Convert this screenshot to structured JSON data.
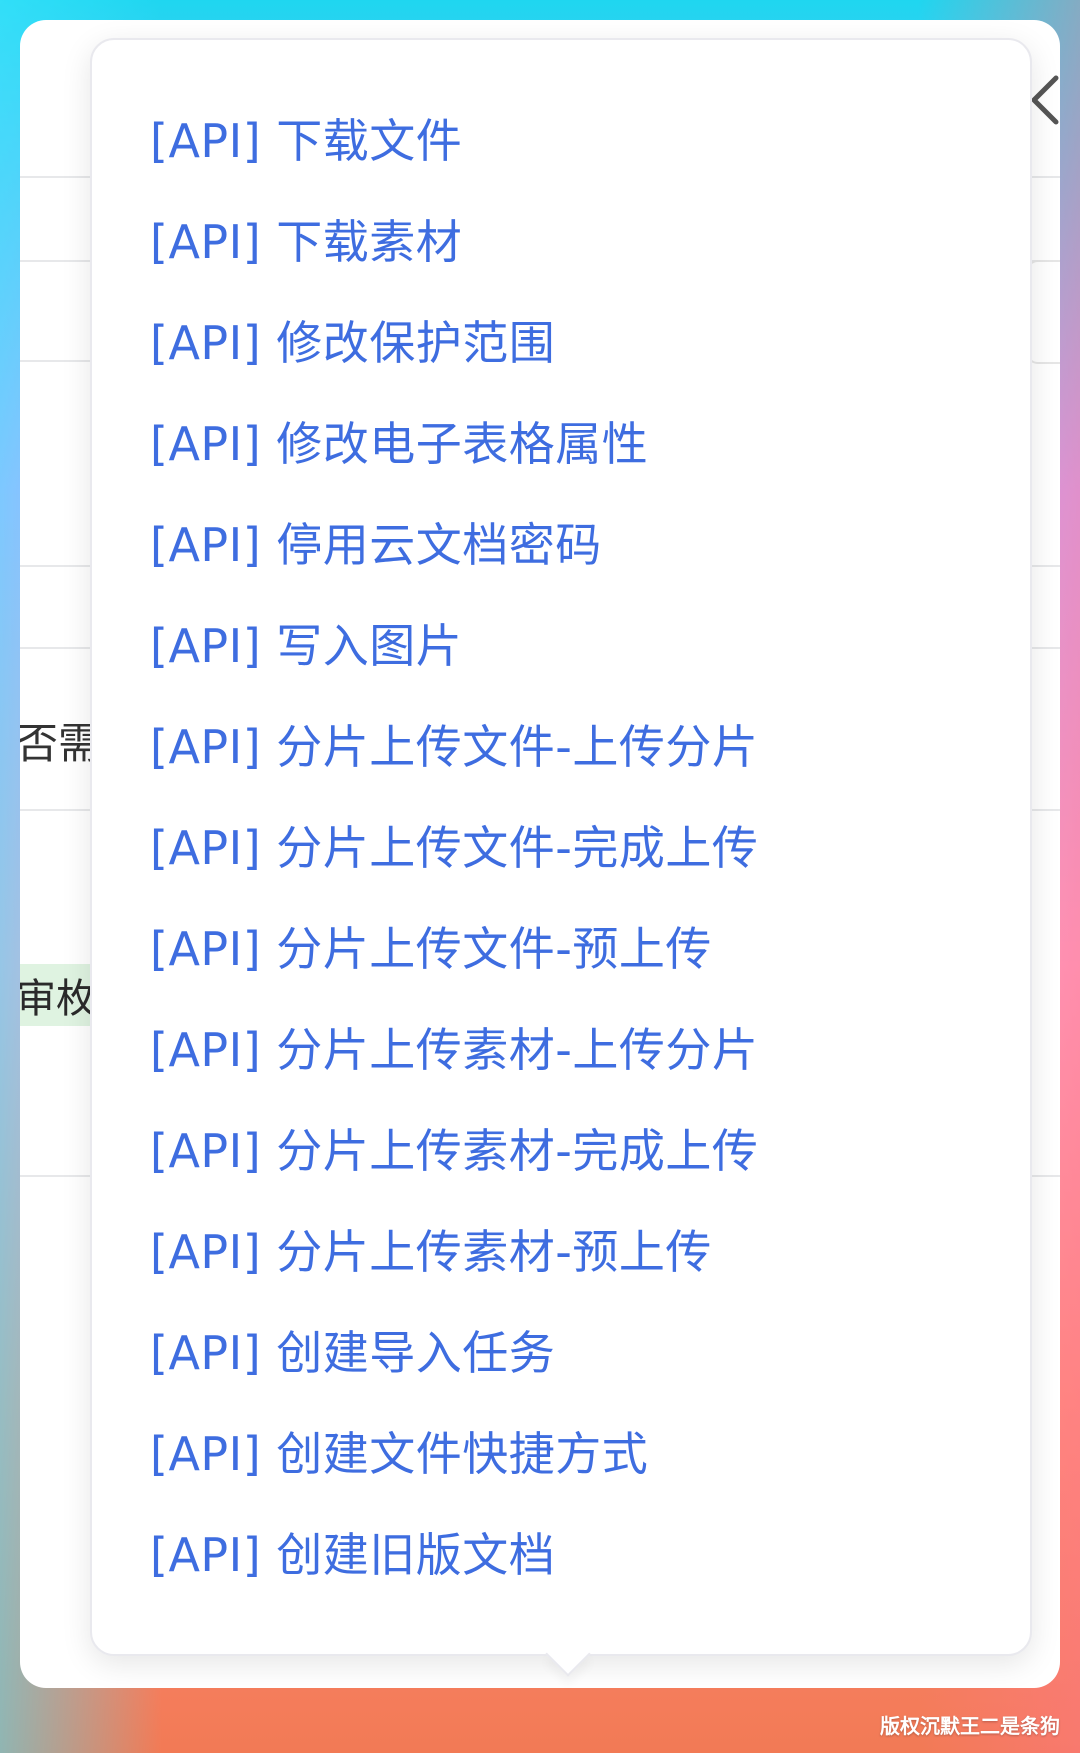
{
  "background_panel": {
    "partial_text_1": "否需",
    "partial_tag_text": "审枚"
  },
  "menu": {
    "items": [
      "[API] 下载文件",
      "[API] 下载素材",
      "[API] 修改保护范围",
      "[API] 修改电子表格属性",
      "[API] 停用云文档密码",
      "[API] 写入图片",
      "[API] 分片上传文件-上传分片",
      "[API] 分片上传文件-完成上传",
      "[API] 分片上传文件-预上传",
      "[API] 分片上传素材-上传分片",
      "[API] 分片上传素材-完成上传",
      "[API] 分片上传素材-预上传",
      "[API] 创建导入任务",
      "[API] 创建文件快捷方式",
      "[API] 创建旧版文档"
    ]
  },
  "watermark": "版权沉默王二是条狗",
  "colors": {
    "link_blue": "#3e6de0",
    "tag_green_bg": "#dff3e1",
    "panel_bg": "#ffffff"
  },
  "icons": {
    "close": "chevron-left-icon"
  }
}
